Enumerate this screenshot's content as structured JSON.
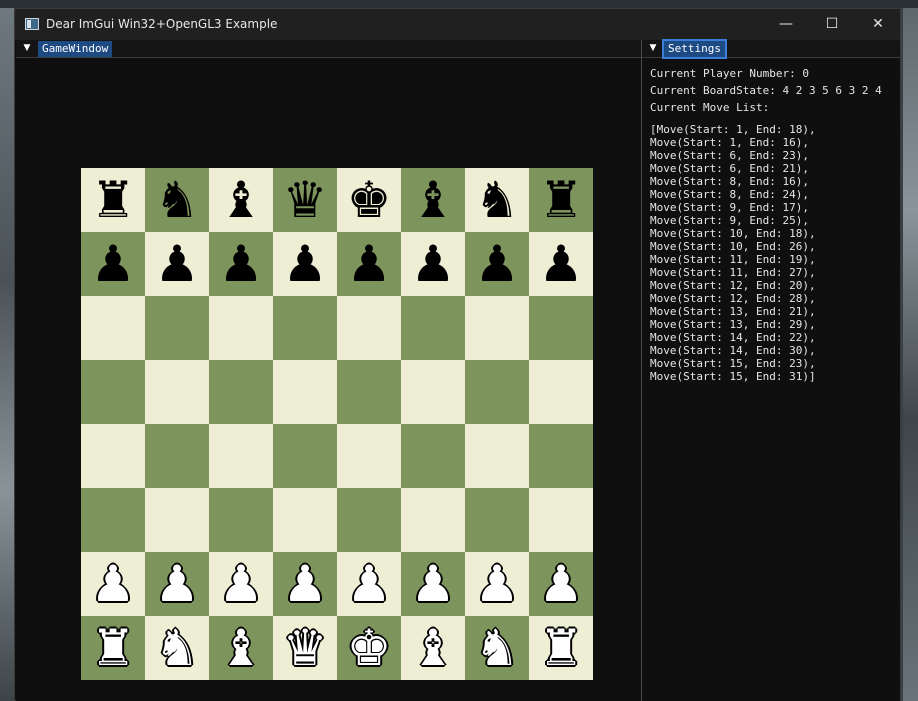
{
  "window": {
    "title": "Dear ImGui Win32+OpenGL3 Example",
    "minimize_glyph": "—",
    "maximize_glyph": "☐",
    "close_glyph": "✕"
  },
  "game_window": {
    "tab_label": "GameWindow",
    "collapse_glyph": "▼"
  },
  "settings": {
    "tab_label": "Settings",
    "collapse_glyph": "▼",
    "player_line": "Current Player Number: 0",
    "boardstate_line": "Current BoardState: 4 2 3 5 6 3 2 4",
    "move_list_label": "Current Move List:",
    "moves": [
      "[Move(Start: 1, End: 18),",
      "Move(Start: 1, End: 16),",
      "Move(Start: 6, End: 23),",
      "Move(Start: 6, End: 21),",
      "Move(Start: 8, End: 16),",
      "Move(Start: 8, End: 24),",
      "Move(Start: 9, End: 17),",
      "Move(Start: 9, End: 25),",
      "Move(Start: 10, End: 18),",
      "Move(Start: 10, End: 26),",
      "Move(Start: 11, End: 19),",
      "Move(Start: 11, End: 27),",
      "Move(Start: 12, End: 20),",
      "Move(Start: 12, End: 28),",
      "Move(Start: 13, End: 21),",
      "Move(Start: 13, End: 29),",
      "Move(Start: 14, End: 22),",
      "Move(Start: 14, End: 30),",
      "Move(Start: 15, End: 23),",
      "Move(Start: 15, End: 31)]"
    ]
  },
  "board": {
    "light_color": "#eeeed5",
    "dark_color": "#7d945d",
    "rows": [
      [
        "br",
        "bn",
        "bb",
        "bq",
        "bk",
        "bb",
        "bn",
        "br"
      ],
      [
        "bp",
        "bp",
        "bp",
        "bp",
        "bp",
        "bp",
        "bp",
        "bp"
      ],
      [
        "",
        "",
        "",
        "",
        "",
        "",
        "",
        ""
      ],
      [
        "",
        "",
        "",
        "",
        "",
        "",
        "",
        ""
      ],
      [
        "",
        "",
        "",
        "",
        "",
        "",
        "",
        ""
      ],
      [
        "",
        "",
        "",
        "",
        "",
        "",
        "",
        ""
      ],
      [
        "wp",
        "wp",
        "wp",
        "wp",
        "wp",
        "wp",
        "wp",
        "wp"
      ],
      [
        "wr",
        "wn",
        "wb",
        "wq",
        "wk",
        "wb",
        "wn",
        "wr"
      ]
    ]
  }
}
